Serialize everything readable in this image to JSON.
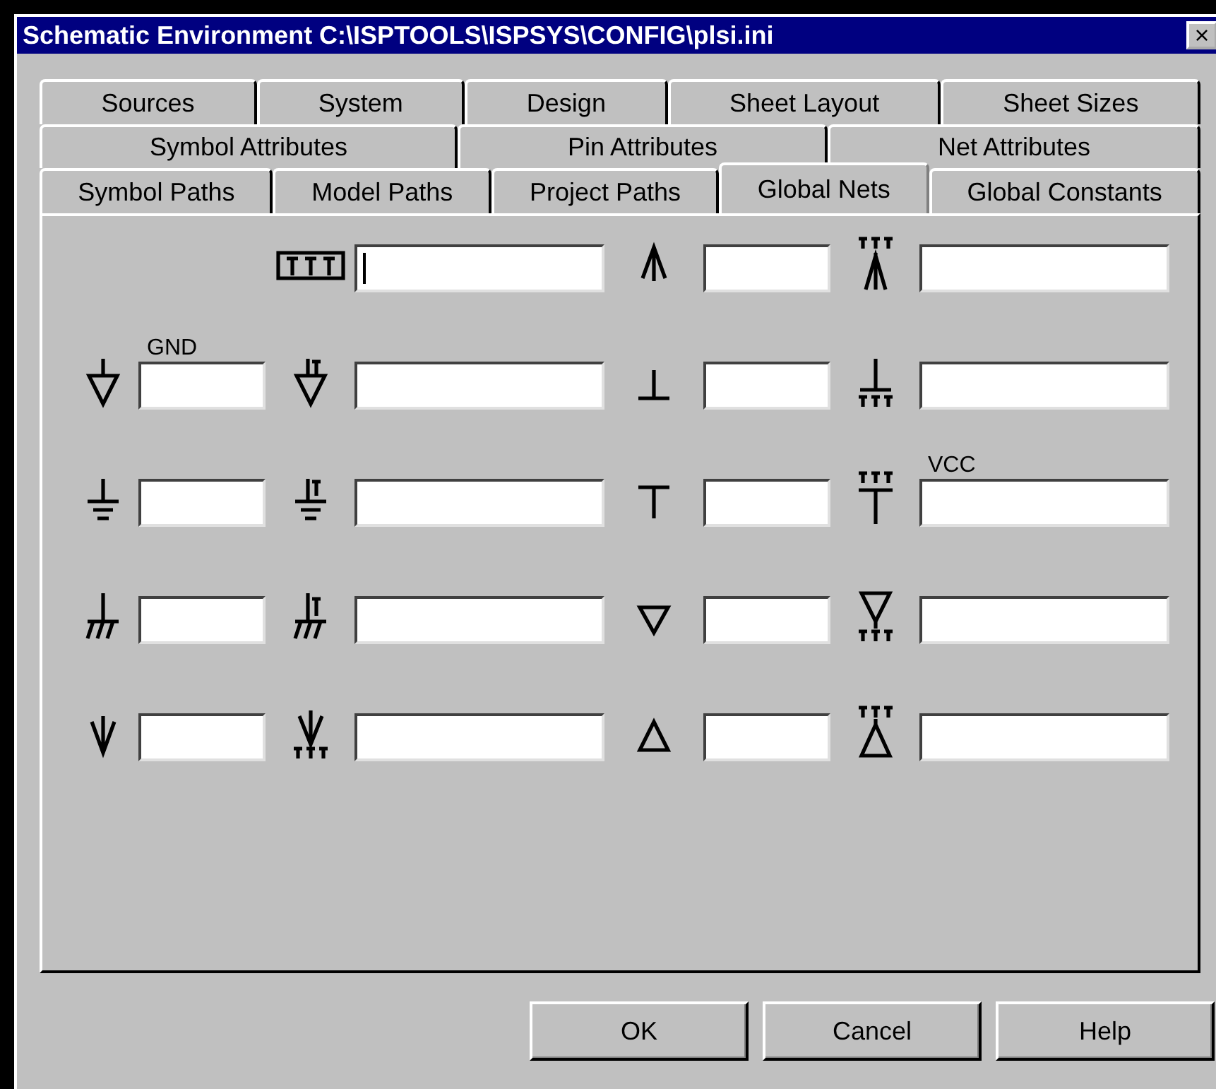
{
  "window": {
    "title": "Schematic Environment C:\\ISPTOOLS\\ISPSYS\\CONFIG\\plsi.ini",
    "close": "×"
  },
  "tab_rows": [
    [
      {
        "label": "Sources",
        "selected": false
      },
      {
        "label": "System",
        "selected": false
      },
      {
        "label": "Design",
        "selected": false
      },
      {
        "label": "Sheet Layout",
        "selected": false
      },
      {
        "label": "Sheet Sizes",
        "selected": false
      }
    ],
    [
      {
        "label": "Symbol Attributes",
        "selected": false
      },
      {
        "label": "Pin Attributes",
        "selected": false
      },
      {
        "label": "Net Attributes",
        "selected": false
      }
    ],
    [
      {
        "label": "Symbol Paths",
        "selected": false
      },
      {
        "label": "Model Paths",
        "selected": false
      },
      {
        "label": "Project Paths",
        "selected": false
      },
      {
        "label": "Global Nets",
        "selected": true
      },
      {
        "label": "Global Constants",
        "selected": false
      }
    ]
  ],
  "net_rows": [
    [
      {
        "focused": true
      },
      {
        "focused": false
      },
      {
        "focused": false
      }
    ],
    [
      {
        "label": "GND",
        "focused": false
      },
      {
        "focused": false
      },
      {
        "focused": false
      },
      {
        "focused": false
      }
    ],
    [
      {
        "focused": false
      },
      {
        "focused": false
      },
      {
        "focused": false
      },
      {
        "label": "VCC",
        "focused": false
      }
    ],
    [
      {
        "focused": false
      },
      {
        "focused": false
      },
      {
        "focused": false
      },
      {
        "focused": false
      }
    ],
    [
      {
        "focused": false
      },
      {
        "focused": false
      },
      {
        "focused": false
      },
      {
        "focused": false
      }
    ]
  ],
  "buttons": [
    "OK",
    "Cancel",
    "Help"
  ]
}
